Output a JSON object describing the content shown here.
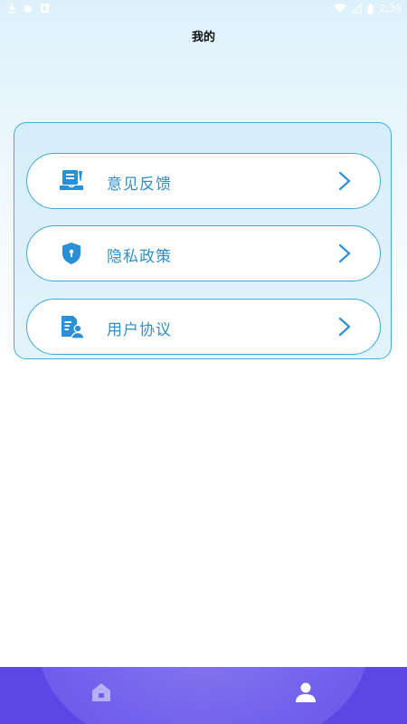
{
  "status_bar": {
    "time": "2:39"
  },
  "header": {
    "title": "我的"
  },
  "menu": {
    "items": [
      {
        "label": "意见反馈",
        "icon": "feedback-icon"
      },
      {
        "label": "隐私政策",
        "icon": "privacy-shield-icon"
      },
      {
        "label": "用户协议",
        "icon": "user-agreement-icon"
      }
    ]
  },
  "bottom_nav": {
    "tabs": [
      {
        "icon": "home-icon",
        "active": false
      },
      {
        "icon": "user-icon",
        "active": true
      }
    ]
  },
  "colors": {
    "accent": "#3aa8df",
    "label": "#2f8fcc",
    "nav_background": "#5d46e5"
  }
}
